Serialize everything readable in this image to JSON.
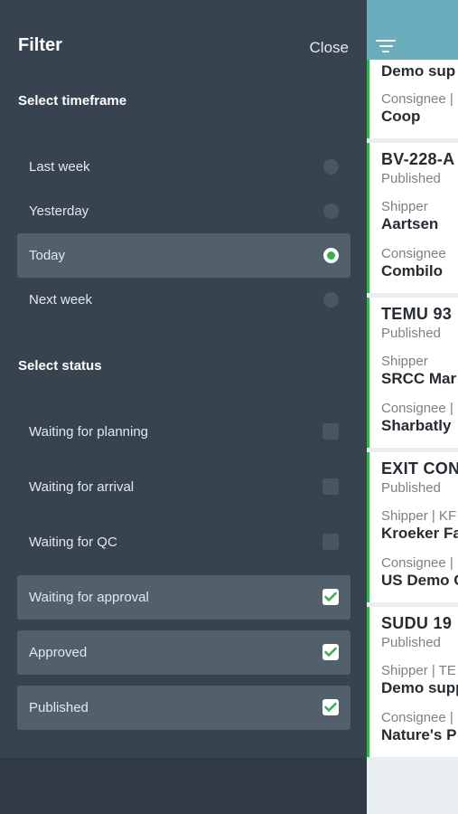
{
  "filter": {
    "title": "Filter",
    "close_label": "Close",
    "timeframe_heading": "Select timeframe",
    "timeframes": [
      {
        "label": "Last week",
        "selected": false
      },
      {
        "label": "Yesterday",
        "selected": false
      },
      {
        "label": "Today",
        "selected": true
      },
      {
        "label": "Next week",
        "selected": false
      }
    ],
    "status_heading": "Select status",
    "statuses": [
      {
        "label": "Waiting for planning",
        "checked": false
      },
      {
        "label": "Waiting for arrival",
        "checked": false
      },
      {
        "label": "Waiting for QC",
        "checked": false
      },
      {
        "label": "Waiting for approval",
        "checked": true
      },
      {
        "label": "Approved",
        "checked": true
      },
      {
        "label": "Published",
        "checked": true
      }
    ]
  },
  "list": {
    "cards": [
      {
        "ref": "Demo sup",
        "status": "",
        "shipper_label": "",
        "shipper": "",
        "consignee_label": "Consignee |",
        "consignee": "Coop"
      },
      {
        "ref": "BV-228-A",
        "status": "Published",
        "shipper_label": "Shipper",
        "shipper": "Aartsen",
        "consignee_label": "Consignee",
        "consignee": "Combilo"
      },
      {
        "ref": "TEMU 93",
        "status": "Published",
        "shipper_label": "Shipper",
        "shipper": "SRCC Mar",
        "consignee_label": "Consignee |",
        "consignee": "Sharbatly"
      },
      {
        "ref": "EXIT CON",
        "status": "Published",
        "shipper_label": "Shipper | KF",
        "shipper": "Kroeker Fa",
        "consignee_label": "Consignee |",
        "consignee": "US Demo C"
      },
      {
        "ref": "SUDU 19",
        "status": "Published",
        "shipper_label": "Shipper | TE",
        "shipper": "Demo supp",
        "consignee_label": "Consignee |",
        "consignee": "Nature's P"
      }
    ]
  },
  "colors": {
    "accent": "#36b24a",
    "panel": "#37434e",
    "header": "#6aaebe"
  }
}
